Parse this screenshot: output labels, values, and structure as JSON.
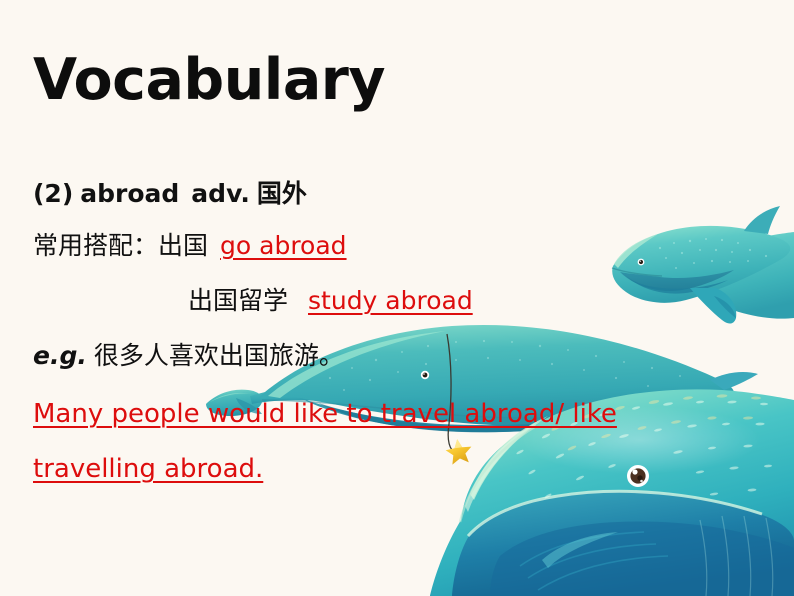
{
  "slide": {
    "background_color": "#fcf8f2",
    "title": "Vocabulary",
    "title_color": "#0d0d0d",
    "accent_red": "#dd0d0d"
  },
  "content": {
    "entry_line": {
      "number": "(2)",
      "word": "abroad",
      "part_of_speech": "adv.",
      "translation": "国外"
    },
    "collocation_label": "常用搭配：",
    "collocations": [
      {
        "chinese": "出国",
        "english": "go abroad"
      },
      {
        "chinese": "出国留学",
        "english": "study abroad"
      }
    ],
    "example_marker": "e.g.",
    "example_chinese": "很多人喜欢出国旅游。",
    "example_english_line1": "Many people would like to travel abroad/ like",
    "example_english_line2": "travelling abroad."
  },
  "artwork": {
    "name": "three-whales-illustration",
    "whale_body_light": "#7fd8cf",
    "whale_body_mid": "#45b8b4",
    "whale_body_dark": "#2a8fa3",
    "whale_belly_dark": "#1f7fa0",
    "star_color": "#f5c733",
    "string_color": "#3a3a32",
    "eye_dark": "#4b2f23",
    "eye_white": "#ffffff",
    "whales": [
      {
        "id": "whale-top-right",
        "size": "small"
      },
      {
        "id": "whale-middle",
        "size": "medium"
      },
      {
        "id": "whale-bottom-large",
        "size": "large"
      }
    ],
    "star": {
      "id": "hanging-star"
    }
  }
}
